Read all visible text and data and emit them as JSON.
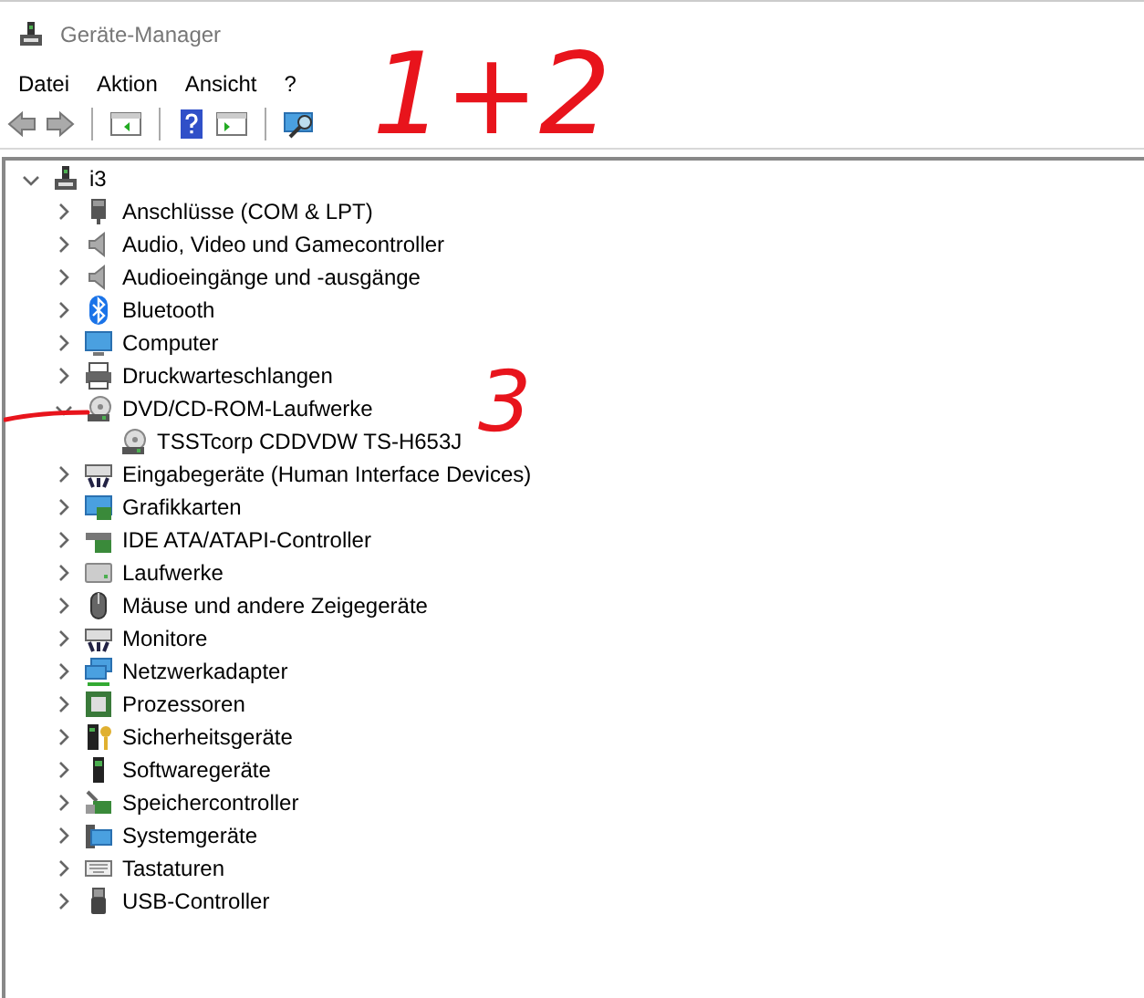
{
  "window": {
    "title": "Geräte-Manager"
  },
  "menu": [
    "Datei",
    "Aktion",
    "Ansicht",
    "?"
  ],
  "tree": [
    {
      "label": "i3",
      "expanded": true,
      "children": [
        {
          "label": "Anschlüsse (COM & LPT)",
          "expanded": false
        },
        {
          "label": "Audio, Video und Gamecontroller",
          "expanded": false
        },
        {
          "label": "Audioeingänge und -ausgänge",
          "expanded": false
        },
        {
          "label": "Bluetooth",
          "expanded": false
        },
        {
          "label": "Computer",
          "expanded": false
        },
        {
          "label": "Druckwarteschlangen",
          "expanded": false
        },
        {
          "label": "DVD/CD-ROM-Laufwerke",
          "expanded": true,
          "children": [
            {
              "label": "TSSTcorp CDDVDW TS-H653J"
            }
          ]
        },
        {
          "label": "Eingabegeräte (Human Interface Devices)",
          "expanded": false
        },
        {
          "label": "Grafikkarten",
          "expanded": false
        },
        {
          "label": "IDE ATA/ATAPI-Controller",
          "expanded": false
        },
        {
          "label": "Laufwerke",
          "expanded": false
        },
        {
          "label": "Mäuse und andere Zeigegeräte",
          "expanded": false
        },
        {
          "label": "Monitore",
          "expanded": false
        },
        {
          "label": "Netzwerkadapter",
          "expanded": false
        },
        {
          "label": "Prozessoren",
          "expanded": false
        },
        {
          "label": "Sicherheitsgeräte",
          "expanded": false
        },
        {
          "label": "Softwaregeräte",
          "expanded": false
        },
        {
          "label": "Speichercontroller",
          "expanded": false
        },
        {
          "label": "Systemgeräte",
          "expanded": false
        },
        {
          "label": "Tastaturen",
          "expanded": false
        },
        {
          "label": "USB-Controller",
          "expanded": false
        }
      ]
    }
  ],
  "annotations": [
    {
      "text": "1+2"
    },
    {
      "text": "3"
    }
  ]
}
